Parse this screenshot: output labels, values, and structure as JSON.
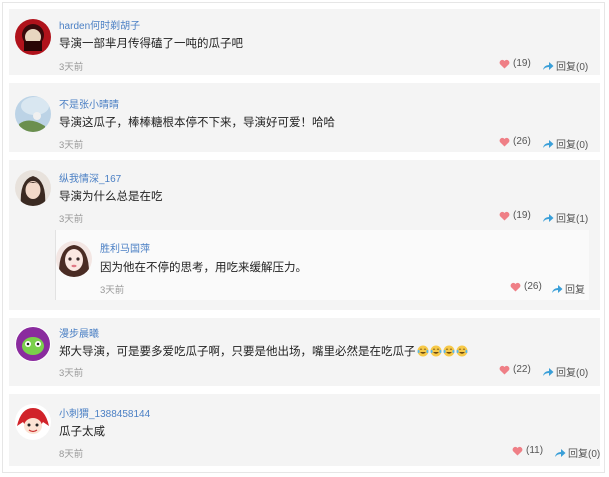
{
  "comments": [
    {
      "username": "harden何时剃胡子",
      "text": "导演一部芈月传得磕了一吨的瓜子吧",
      "time": "3天前",
      "likes": "(19)",
      "reply": "回复(0)"
    },
    {
      "username": "不是张小晴晴",
      "text": "导演这瓜子，棒棒糖根本停不下来，导演好可爱！哈哈",
      "time": "3天前",
      "likes": "(26)",
      "reply": "回复(0)"
    },
    {
      "username": "纵我情深_167",
      "text": "导演为什么总是在吃",
      "time": "3天前",
      "likes": "(19)",
      "reply": "回复(1)",
      "sub_reply": {
        "username": "胜利马国萍",
        "text": "因为他在不停的思考，用吃来缓解压力。",
        "time": "3天前",
        "likes": "(26)",
        "reply": "回复"
      }
    },
    {
      "username": "漫步晨曦",
      "text": "郑大导演，可是要多爱吃瓜子啊，只要是他出场，嘴里必然是在吃瓜子",
      "emoji": [
        "laughing-tears-emoji",
        "laughing-tears-emoji",
        "laughing-tears-emoji",
        "laughing-tears-emoji"
      ],
      "time": "3天前",
      "likes": "(22)",
      "reply": "回复(0)"
    },
    {
      "username": "小刺猬_1388458144",
      "text": "瓜子太咸",
      "time": "8天前",
      "likes": "(11)",
      "reply": "回复(0)"
    }
  ],
  "icons": {
    "like": "heart-icon",
    "reply": "share-arrow-icon"
  },
  "colors": {
    "username": "#4a7fc4",
    "heart": "#ef7f86",
    "arrow": "#3a9fd8",
    "card": "#f4f4f4"
  }
}
